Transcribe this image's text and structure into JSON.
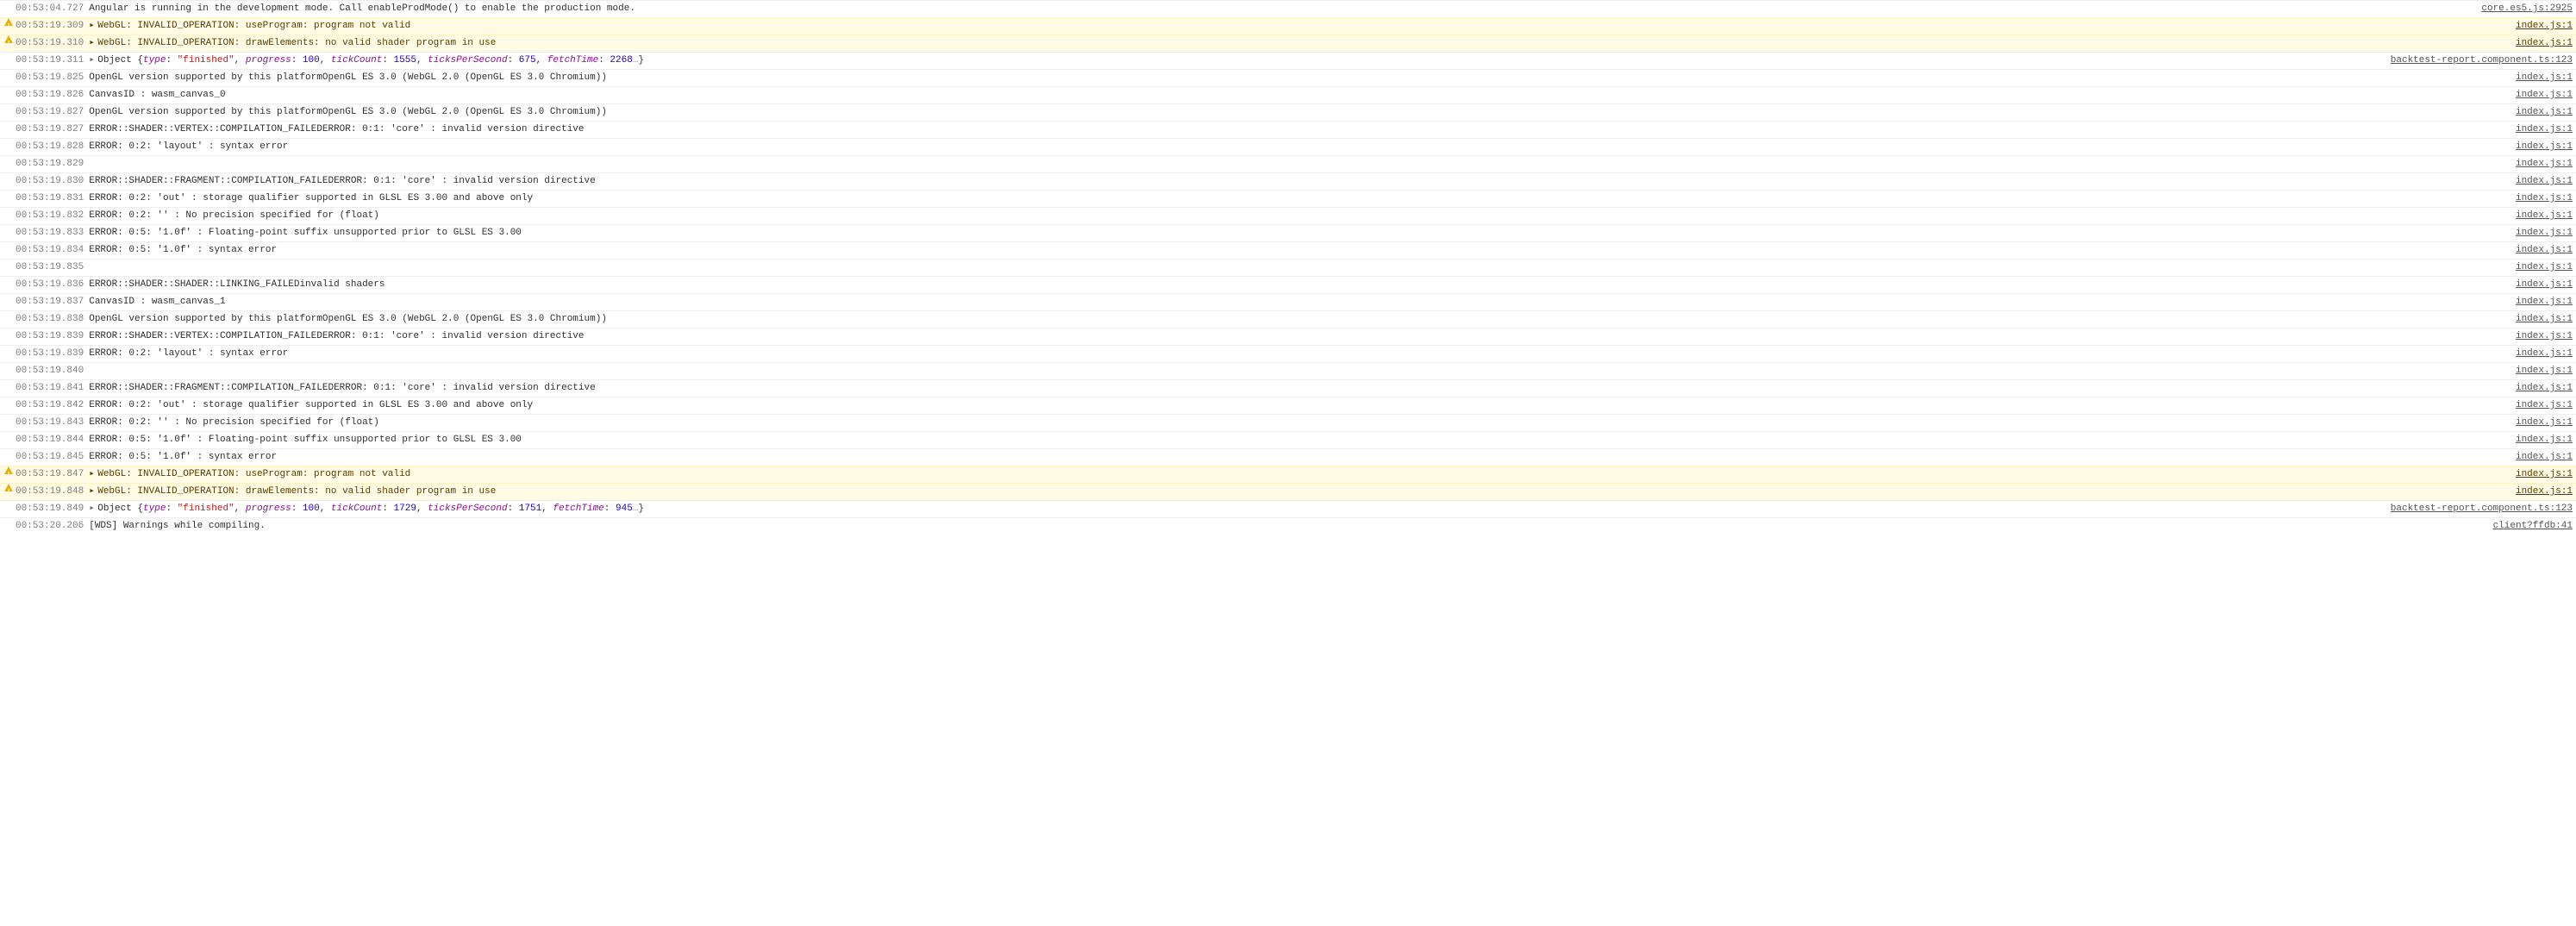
{
  "source_index": "index.js:1",
  "source_core": "core.es5.js:2925",
  "source_backtest": "backtest-report.component.ts:123",
  "source_client": "client?ffdb:41",
  "rows": [
    {
      "type": "plain",
      "ts": "00:53:04.727",
      "msg": "Angular is running in the development mode. Call enableProdMode() to enable the production mode.",
      "src": "core.es5.js:2925"
    },
    {
      "type": "warn",
      "ts": "00:53:19.309",
      "msg": "WebGL: INVALID_OPERATION: useProgram: program not valid",
      "src": "index.js:1",
      "caret": true
    },
    {
      "type": "warn",
      "ts": "00:53:19.310",
      "msg": "WebGL: INVALID_OPERATION: drawElements: no valid shader program in use",
      "src": "index.js:1",
      "caret": true
    },
    {
      "type": "object",
      "ts": "00:53:19.311",
      "src": "backtest-report.component.ts:123",
      "caret": true,
      "obj": [
        {
          "k": "type",
          "v": "\"finished\"",
          "cls": "str"
        },
        {
          "k": "progress",
          "v": "100",
          "cls": "num"
        },
        {
          "k": "tickCount",
          "v": "1555",
          "cls": "num"
        },
        {
          "k": "ticksPerSecond",
          "v": "675",
          "cls": "num"
        },
        {
          "k": "fetchTime",
          "v": "2268",
          "cls": "num",
          "trail": "…"
        }
      ]
    },
    {
      "type": "plain",
      "ts": "00:53:19.825",
      "msg": "OpenGL version supported by this platformOpenGL ES 3.0 (WebGL 2.0 (OpenGL ES 3.0 Chromium))",
      "src": "index.js:1"
    },
    {
      "type": "plain",
      "ts": "00:53:19.826",
      "msg": "CanvasID : wasm_canvas_0",
      "src": "index.js:1"
    },
    {
      "type": "plain",
      "ts": "00:53:19.827",
      "msg": "OpenGL version supported by this platformOpenGL ES 3.0 (WebGL 2.0 (OpenGL ES 3.0 Chromium))",
      "src": "index.js:1"
    },
    {
      "type": "plain",
      "ts": "00:53:19.827",
      "msg": "ERROR::SHADER::VERTEX::COMPILATION_FAILEDERROR: 0:1: 'core' : invalid version directive",
      "src": "index.js:1"
    },
    {
      "type": "plain",
      "ts": "00:53:19.828",
      "msg": "ERROR: 0:2: 'layout' : syntax error",
      "src": "index.js:1"
    },
    {
      "type": "plain",
      "ts": "00:53:19.829",
      "msg": "",
      "src": "index.js:1"
    },
    {
      "type": "plain",
      "ts": "00:53:19.830",
      "msg": "ERROR::SHADER::FRAGMENT::COMPILATION_FAILEDERROR: 0:1: 'core' : invalid version directive",
      "src": "index.js:1"
    },
    {
      "type": "plain",
      "ts": "00:53:19.831",
      "msg": "ERROR: 0:2: 'out' : storage qualifier supported in GLSL ES 3.00 and above only",
      "src": "index.js:1"
    },
    {
      "type": "plain",
      "ts": "00:53:19.832",
      "msg": "ERROR: 0:2: '' : No precision specified for (float)",
      "src": "index.js:1"
    },
    {
      "type": "plain",
      "ts": "00:53:19.833",
      "msg": "ERROR: 0:5: '1.0f' : Floating-point suffix unsupported prior to GLSL ES 3.00",
      "src": "index.js:1"
    },
    {
      "type": "plain",
      "ts": "00:53:19.834",
      "msg": "ERROR: 0:5: '1.0f' : syntax error",
      "src": "index.js:1"
    },
    {
      "type": "plain",
      "ts": "00:53:19.835",
      "msg": "",
      "src": "index.js:1"
    },
    {
      "type": "plain",
      "ts": "00:53:19.836",
      "msg": "ERROR::SHADER::SHADER::LINKING_FAILEDinvalid shaders",
      "src": "index.js:1"
    },
    {
      "type": "plain",
      "ts": "00:53:19.837",
      "msg": "CanvasID : wasm_canvas_1",
      "src": "index.js:1"
    },
    {
      "type": "plain",
      "ts": "00:53:19.838",
      "msg": "OpenGL version supported by this platformOpenGL ES 3.0 (WebGL 2.0 (OpenGL ES 3.0 Chromium))",
      "src": "index.js:1"
    },
    {
      "type": "plain",
      "ts": "00:53:19.839",
      "msg": "ERROR::SHADER::VERTEX::COMPILATION_FAILEDERROR: 0:1: 'core' : invalid version directive",
      "src": "index.js:1"
    },
    {
      "type": "plain",
      "ts": "00:53:19.839",
      "msg": "ERROR: 0:2: 'layout' : syntax error",
      "src": "index.js:1"
    },
    {
      "type": "plain",
      "ts": "00:53:19.840",
      "msg": "",
      "src": "index.js:1"
    },
    {
      "type": "plain",
      "ts": "00:53:19.841",
      "msg": "ERROR::SHADER::FRAGMENT::COMPILATION_FAILEDERROR: 0:1: 'core' : invalid version directive",
      "src": "index.js:1"
    },
    {
      "type": "plain",
      "ts": "00:53:19.842",
      "msg": "ERROR: 0:2: 'out' : storage qualifier supported in GLSL ES 3.00 and above only",
      "src": "index.js:1"
    },
    {
      "type": "plain",
      "ts": "00:53:19.843",
      "msg": "ERROR: 0:2: '' : No precision specified for (float)",
      "src": "index.js:1"
    },
    {
      "type": "plain",
      "ts": "00:53:19.844",
      "msg": "ERROR: 0:5: '1.0f' : Floating-point suffix unsupported prior to GLSL ES 3.00",
      "src": "index.js:1"
    },
    {
      "type": "plain",
      "ts": "00:53:19.845",
      "msg": "ERROR: 0:5: '1.0f' : syntax error",
      "src": "index.js:1"
    },
    {
      "type": "warn",
      "ts": "00:53:19.847",
      "msg": "WebGL: INVALID_OPERATION: useProgram: program not valid",
      "src": "index.js:1",
      "caret": true
    },
    {
      "type": "warn",
      "ts": "00:53:19.848",
      "msg": "WebGL: INVALID_OPERATION: drawElements: no valid shader program in use",
      "src": "index.js:1",
      "caret": true
    },
    {
      "type": "object",
      "ts": "00:53:19.849",
      "src": "backtest-report.component.ts:123",
      "caret": true,
      "obj": [
        {
          "k": "type",
          "v": "\"finished\"",
          "cls": "str"
        },
        {
          "k": "progress",
          "v": "100",
          "cls": "num"
        },
        {
          "k": "tickCount",
          "v": "1729",
          "cls": "num"
        },
        {
          "k": "ticksPerSecond",
          "v": "1751",
          "cls": "num"
        },
        {
          "k": "fetchTime",
          "v": "945",
          "cls": "num",
          "trail": "…"
        }
      ]
    },
    {
      "type": "plain",
      "ts": "00:53:20.206",
      "msg": "[WDS] Warnings while compiling.",
      "src": "client?ffdb:41"
    }
  ]
}
